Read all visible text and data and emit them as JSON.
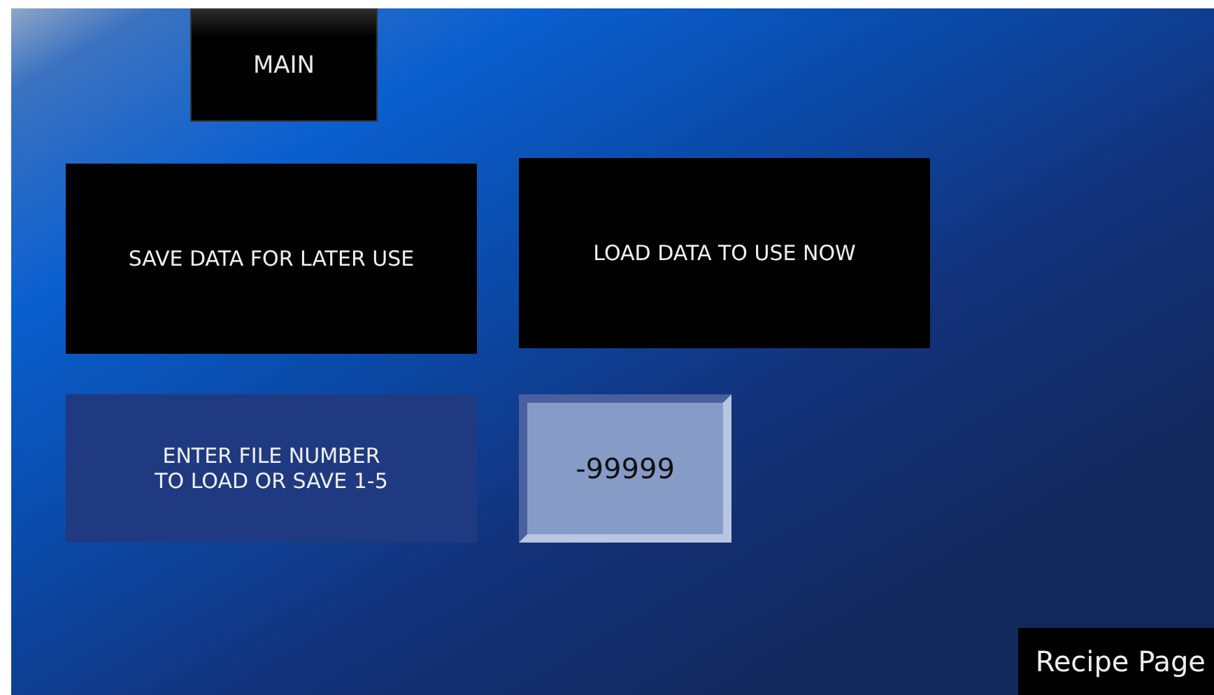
{
  "nav_button": {
    "label": "MAIN"
  },
  "actions": [
    {
      "label": "SAVE DATA FOR LATER USE"
    },
    {
      "label": "LOAD DATA TO USE NOW"
    }
  ],
  "file_number": {
    "label_lines": [
      "ENTER FILE NUMBER",
      "TO LOAD OR SAVE 1-5"
    ],
    "value": "-99999"
  },
  "page_title": "Recipe Page"
}
